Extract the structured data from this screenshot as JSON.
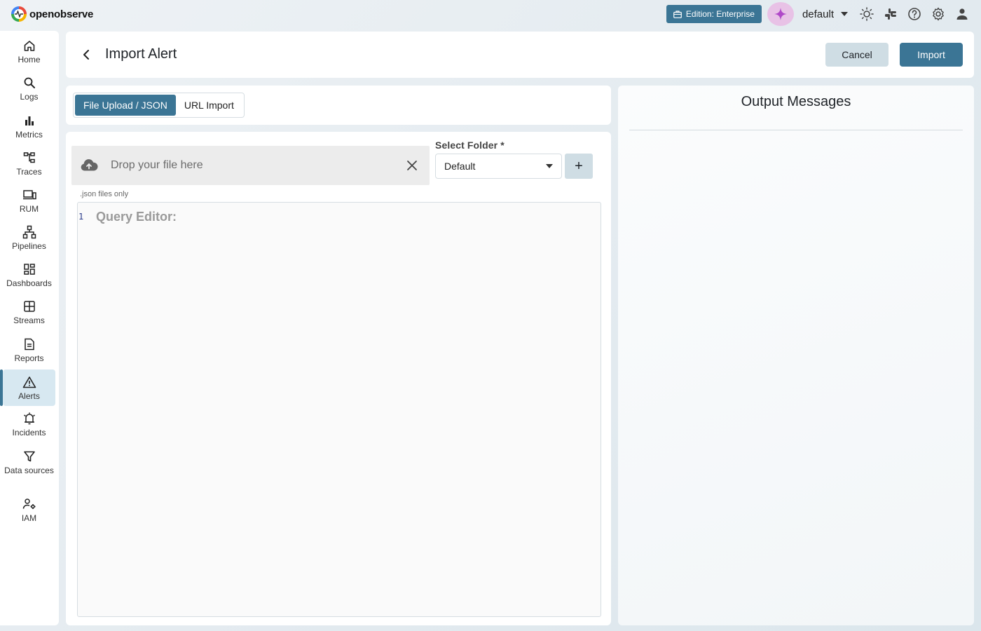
{
  "app": {
    "logo_text": "openobserve"
  },
  "topbar": {
    "edition_label": "Edition: Enterprise",
    "org_name": "default"
  },
  "sidebar": {
    "items": [
      {
        "label": "Home",
        "icon": "home-icon"
      },
      {
        "label": "Logs",
        "icon": "search-icon"
      },
      {
        "label": "Metrics",
        "icon": "bar-chart-icon"
      },
      {
        "label": "Traces",
        "icon": "traces-icon"
      },
      {
        "label": "RUM",
        "icon": "devices-icon"
      },
      {
        "label": "Pipelines",
        "icon": "pipelines-icon"
      },
      {
        "label": "Dashboards",
        "icon": "dashboard-icon"
      },
      {
        "label": "Streams",
        "icon": "grid-icon"
      },
      {
        "label": "Reports",
        "icon": "document-icon"
      },
      {
        "label": "Alerts",
        "icon": "warning-icon",
        "active": true
      },
      {
        "label": "Incidents",
        "icon": "alarm-icon"
      },
      {
        "label": "Data sources",
        "icon": "filter-icon"
      },
      {
        "label": "IAM",
        "icon": "users-gear-icon"
      }
    ]
  },
  "header": {
    "title": "Import Alert",
    "cancel_label": "Cancel",
    "import_label": "Import"
  },
  "tabs": [
    {
      "label": "File Upload / JSON",
      "active": true
    },
    {
      "label": "URL Import",
      "active": false
    }
  ],
  "upload": {
    "drop_text": "Drop your file here",
    "hint": ".json files only",
    "folder_label": "Select Folder *",
    "folder_value": "Default",
    "add_label": "+"
  },
  "editor": {
    "line_number": "1",
    "placeholder": "Query Editor:"
  },
  "output": {
    "title": "Output Messages"
  },
  "colors": {
    "primary": "#3b7595",
    "secondary_button": "#cfdde4",
    "active_nav": "#d7e8f1"
  }
}
